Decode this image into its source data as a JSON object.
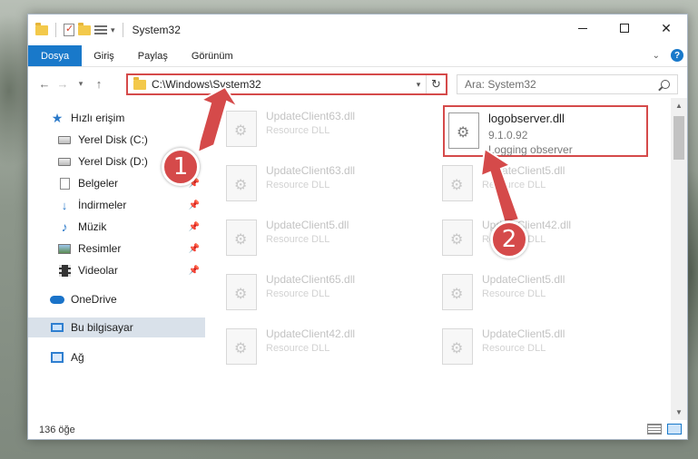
{
  "window": {
    "title": "System32",
    "controls": {
      "minimize": "",
      "maximize": "",
      "close": "✕"
    }
  },
  "ribbon": {
    "tabs": [
      "Dosya",
      "Giriş",
      "Paylaş",
      "Görünüm"
    ],
    "expand_icon": "chevron-down",
    "help_label": "?"
  },
  "nav": {
    "back": "←",
    "forward": "→",
    "recent": "▾",
    "up": "↑",
    "address": "C:\\Windows\\System32",
    "address_dropdown": "▾",
    "refresh": "↻",
    "search_placeholder": "Ara: System32"
  },
  "sidebar": {
    "items": [
      {
        "label": "Hızlı erişim",
        "icon": "star-icon",
        "pinned": false
      },
      {
        "label": "Yerel Disk (C:)",
        "icon": "drive-icon",
        "pinned": false
      },
      {
        "label": "Yerel Disk (D:)",
        "icon": "drive-icon",
        "pinned": false
      },
      {
        "label": "Belgeler",
        "icon": "documents-icon",
        "pinned": true
      },
      {
        "label": "İndirmeler",
        "icon": "download-icon",
        "pinned": true
      },
      {
        "label": "Müzik",
        "icon": "music-icon",
        "pinned": true
      },
      {
        "label": "Resimler",
        "icon": "pictures-icon",
        "pinned": true
      },
      {
        "label": "Videolar",
        "icon": "video-icon",
        "pinned": true
      },
      {
        "label": "OneDrive",
        "icon": "cloud-icon",
        "pinned": false
      },
      {
        "label": "Bu bilgisayar",
        "icon": "computer-icon",
        "pinned": false,
        "selected": true
      },
      {
        "label": "Ağ",
        "icon": "network-icon",
        "pinned": false
      }
    ]
  },
  "files": {
    "left": [
      {
        "name": "UpdateClient63.dll",
        "desc": "Resource DLL"
      },
      {
        "name": "UpdateClient63.dll",
        "desc": "Resource DLL"
      },
      {
        "name": "UpdateClient5.dll",
        "desc": "Resource DLL"
      },
      {
        "name": "UpdateClient65.dll",
        "desc": "Resource DLL"
      },
      {
        "name": "UpdateClient42.dll",
        "desc": "Resource DLL"
      }
    ],
    "right": [
      {
        "name": "UpdateClient5.dll",
        "desc": "Resource DLL"
      },
      {
        "name": "UpdateClient42.dll",
        "desc": "Resource DLL"
      },
      {
        "name": "UpdateClient5.dll",
        "desc": "Resource DLL"
      },
      {
        "name": "UpdateClient5.dll",
        "desc": "Resource DLL"
      }
    ],
    "highlighted": {
      "name": "logobserver.dll",
      "version": "9.1.0.92",
      "desc": "Logging observer"
    }
  },
  "status": {
    "count": "136 öğe"
  },
  "annotations": {
    "step1": "1",
    "step2": "2",
    "color": "#d54a4a"
  }
}
